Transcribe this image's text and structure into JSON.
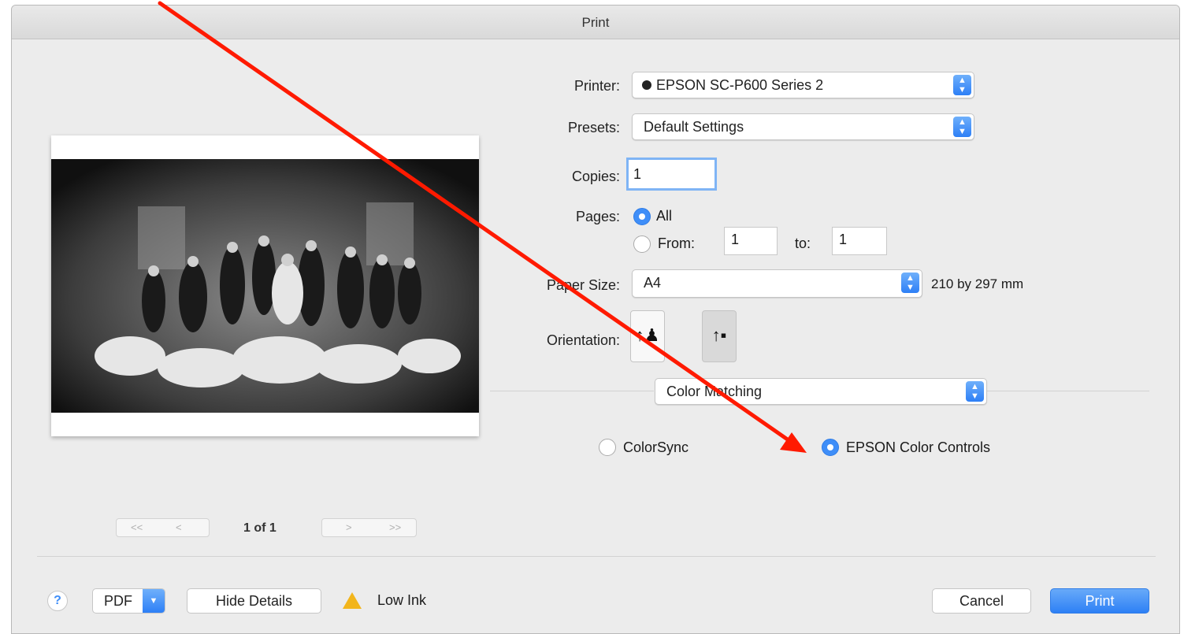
{
  "window": {
    "title": "Print"
  },
  "printer": {
    "label": "Printer:",
    "value": "EPSON SC-P600 Series 2"
  },
  "presets": {
    "label": "Presets:",
    "value": "Default Settings"
  },
  "copies": {
    "label": "Copies:",
    "value": "1"
  },
  "pages": {
    "label": "Pages:",
    "all_label": "All",
    "from_label": "From:",
    "from_value": "1",
    "to_label": "to:",
    "to_value": "1",
    "selected": "All"
  },
  "paper_size": {
    "label": "Paper Size:",
    "value": "A4",
    "dimensions": "210 by 297 mm"
  },
  "orientation": {
    "label": "Orientation:",
    "options": [
      "portrait",
      "landscape"
    ],
    "selected": "landscape"
  },
  "section_popup": {
    "value": "Color Matching"
  },
  "color_matching": {
    "options": [
      "ColorSync",
      "EPSON Color Controls"
    ],
    "selected": "EPSON Color Controls"
  },
  "preview": {
    "page_indicator": "1 of 1",
    "nav": {
      "first": "<<",
      "prev": "<",
      "next": ">",
      "last": ">>"
    },
    "image_description": "black-and-white group photograph"
  },
  "bottom": {
    "help": "?",
    "pdf_label": "PDF",
    "hide_details_label": "Hide Details",
    "low_ink_label": "Low Ink",
    "cancel_label": "Cancel",
    "print_label": "Print"
  },
  "annotation": {
    "arrow_color": "#ff1a00"
  },
  "colors": {
    "accent": "#3f8ef8",
    "window_bg": "#ececec"
  }
}
